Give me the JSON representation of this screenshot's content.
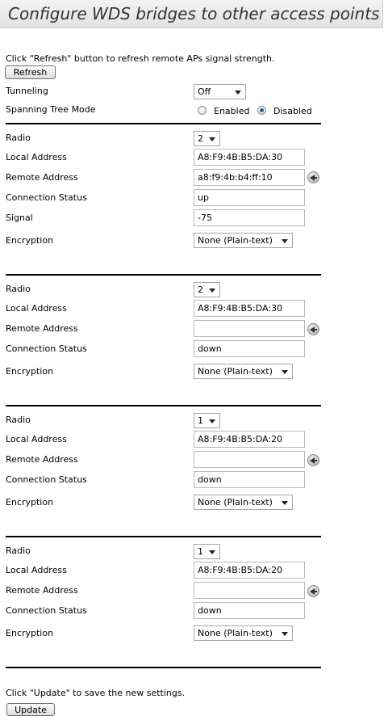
{
  "page_title": "Configure WDS bridges to other access points",
  "refresh_note": "Click \"Refresh\" button to refresh remote APs signal strength.",
  "refresh_label": "Refresh",
  "tunneling": {
    "label": "Tunneling",
    "value": "Off"
  },
  "spanning_tree": {
    "label": "Spanning Tree Mode",
    "enabled_label": "Enabled",
    "disabled_label": "Disabled",
    "selected": "Disabled"
  },
  "labels": {
    "radio": "Radio",
    "local_address": "Local Address",
    "remote_address": "Remote Address",
    "connection_status": "Connection Status",
    "signal": "Signal",
    "encryption": "Encryption"
  },
  "bridges": [
    {
      "radio": "2",
      "local_address": "A8:F9:4B:B5:DA:30",
      "remote_address": "a8:f9:4b:b4:ff:10",
      "connection_status": "up",
      "signal": "-75",
      "encryption": "None (Plain-text)"
    },
    {
      "radio": "2",
      "local_address": "A8:F9:4B:B5:DA:30",
      "remote_address": "",
      "connection_status": "down",
      "encryption": "None (Plain-text)"
    },
    {
      "radio": "1",
      "local_address": "A8:F9:4B:B5:DA:20",
      "remote_address": "",
      "connection_status": "down",
      "encryption": "None (Plain-text)"
    },
    {
      "radio": "1",
      "local_address": "A8:F9:4B:B5:DA:20",
      "remote_address": "",
      "connection_status": "down",
      "encryption": "None (Plain-text)"
    }
  ],
  "update_note": "Click \"Update\" to save the new settings.",
  "update_label": "Update",
  "icons": {
    "dropdown": "chevron-down-icon",
    "select_remote": "arrow-left-circle-icon",
    "radio_button": "radio-icon"
  },
  "colors": {
    "title_bar": "#e9e9e9",
    "title_text": "#333333",
    "radio_selected": "#2c5fa8"
  }
}
